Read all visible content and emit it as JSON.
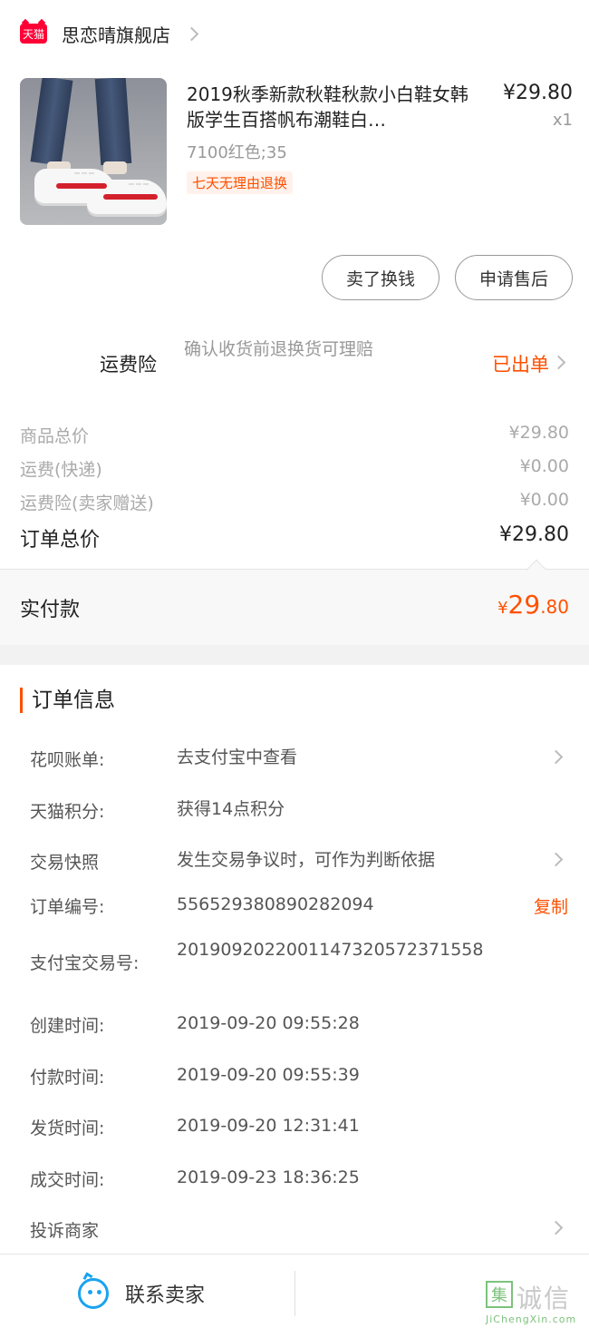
{
  "shop": {
    "logo_text": "天猫",
    "name": "思恋晴旗舰店"
  },
  "product": {
    "title": "2019秋季新款秋鞋秋款小白鞋女韩版学生百搭帆布潮鞋白…",
    "spec": "7100红色;35",
    "tag": "七天无理由退换",
    "price": "¥29.80",
    "qty": "x1"
  },
  "actions": {
    "sell_label": "卖了换钱",
    "after_sale_label": "申请售后"
  },
  "insurance": {
    "label": "运费险",
    "desc": "确认收货前退换货可理赔",
    "status": "已出单"
  },
  "price_rows": [
    {
      "label": "商品总价",
      "value": "¥29.80"
    },
    {
      "label": "运费(快递)",
      "value": "¥0.00"
    },
    {
      "label": "运费险(卖家赠送)",
      "value": "¥0.00"
    }
  ],
  "order_total": {
    "label": "订单总价",
    "value": "¥29.80"
  },
  "paid": {
    "label": "实付款",
    "currency": "¥",
    "int": "29",
    "dec": ".80"
  },
  "order_info": {
    "title": "订单信息",
    "rows": [
      {
        "label": "花呗账单:",
        "value": "去支付宝中查看"
      },
      {
        "label": "天猫积分:",
        "value": "获得14点积分"
      },
      {
        "label": "交易快照",
        "value": "发生交易争议时，可作为判断依据"
      },
      {
        "label": "订单编号:",
        "value": "556529380890282094",
        "action": "复制"
      },
      {
        "label": "支付宝交易号:",
        "value": "2019092022001147320572371558"
      },
      {
        "label": "创建时间:",
        "value": "2019-09-20 09:55:28"
      },
      {
        "label": "付款时间:",
        "value": "2019-09-20 09:55:39"
      },
      {
        "label": "发货时间:",
        "value": "2019-09-20 12:31:41"
      },
      {
        "label": "成交时间:",
        "value": "2019-09-23 18:36:25"
      },
      {
        "label": "投诉商家",
        "value": ""
      }
    ]
  },
  "bottom": {
    "contact_label": "联系卖家"
  },
  "watermark": {
    "box_char": "集",
    "text": "诚信",
    "sub": "JiChengXin.com"
  },
  "colors": {
    "accent": "#ff5000",
    "tmall_red": "#ff0036",
    "contact_blue": "#1aa3f0"
  },
  "icons": [
    "tmall-logo",
    "chevron-right-icon",
    "contact-seller-icon"
  ]
}
